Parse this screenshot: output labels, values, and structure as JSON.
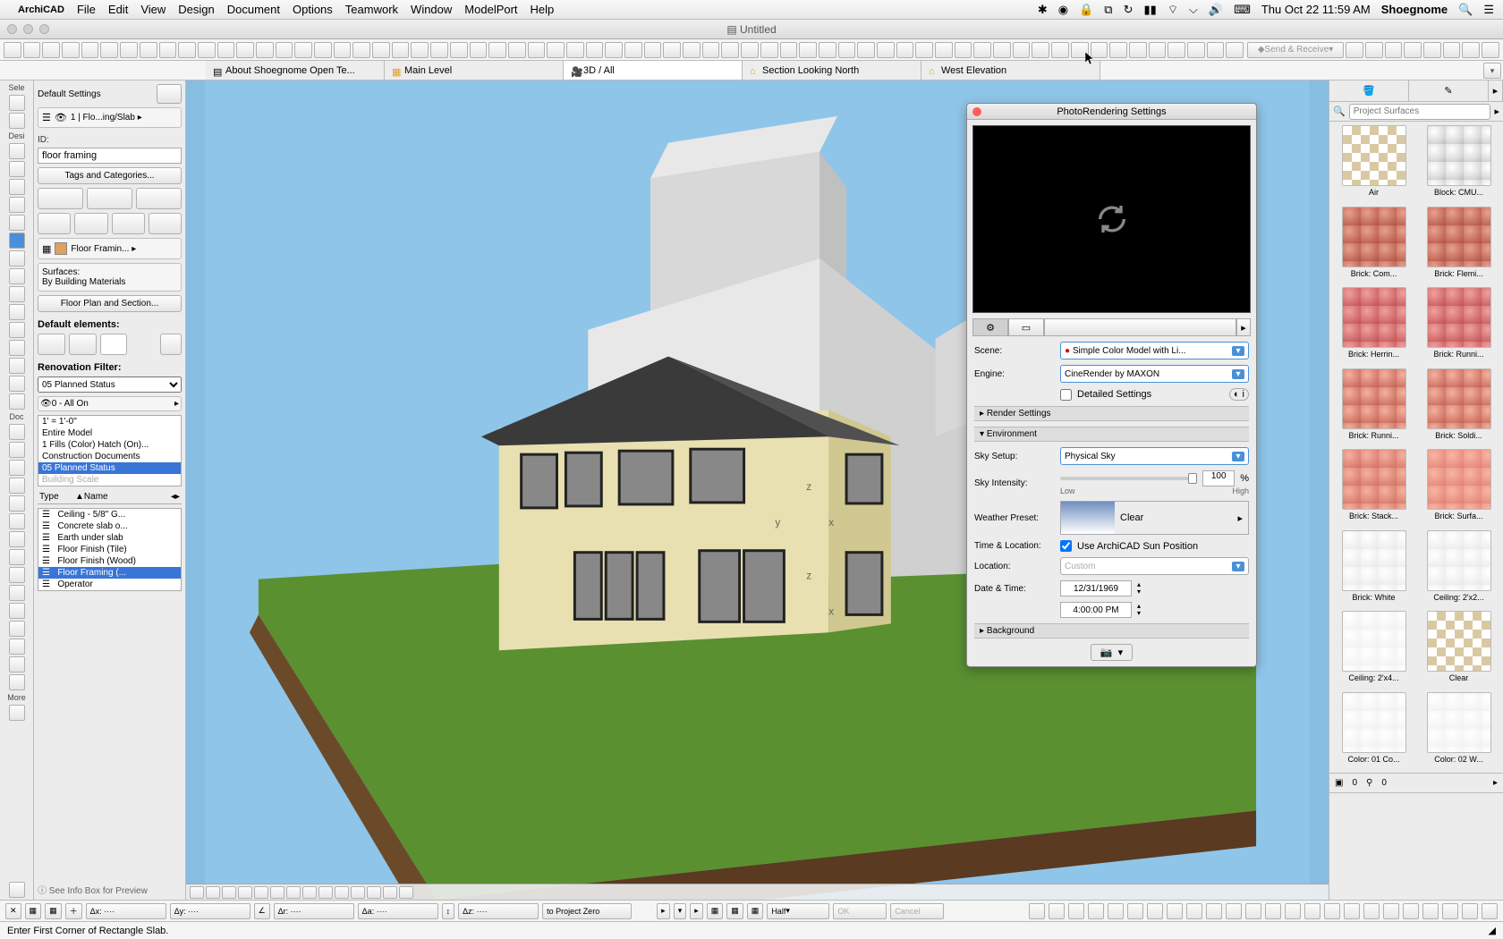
{
  "menubar": {
    "app": "ArchiCAD",
    "items": [
      "File",
      "Edit",
      "View",
      "Design",
      "Document",
      "Options",
      "Teamwork",
      "Window",
      "ModelPort",
      "Help"
    ],
    "clock": "Thu Oct 22  11:59 AM",
    "user": "Shoegnome"
  },
  "window": {
    "title": "Untitled"
  },
  "tabs": [
    {
      "label": "About Shoegnome Open Te...",
      "icon": "doc",
      "active": false
    },
    {
      "label": "Main Level",
      "icon": "plan",
      "active": false
    },
    {
      "label": "3D / All",
      "icon": "camera",
      "active": true
    },
    {
      "label": "Section Looking North",
      "icon": "section",
      "active": false
    },
    {
      "label": "West Elevation",
      "icon": "elev",
      "active": false
    }
  ],
  "leftpanel": {
    "sele": "Sele",
    "desi": "Desi",
    "doc": "Doc",
    "more": "More",
    "default_settings": "Default Settings",
    "layer_row": "1 | Flo...ing/Slab ▸",
    "id_label": "ID:",
    "id_value": "floor framing",
    "tags_btn": "Tags and Categories...",
    "composite": "Floor Framin... ▸",
    "surfaces_label": "Surfaces:",
    "surfaces_sub": "By Building Materials",
    "floorplan_btn": "Floor Plan and Section...",
    "default_elements": "Default elements:",
    "reno_label": "Renovation Filter:",
    "reno_value": "05 Planned Status",
    "layercombo": "0 - All On",
    "layerlist": [
      "1'        =        1'-0\"",
      "Entire Model",
      "1 Fills (Color) Hatch (On)...",
      "Construction Documents",
      "05 Planned Status",
      "Building Scale"
    ],
    "type_header": "Type",
    "name_header": "Name",
    "layers": [
      "Ceiling - 5/8\" G...",
      "Concrete slab o...",
      "Earth under slab",
      "Floor Finish (Tile)",
      "Floor Finish (Wood)",
      "Floor Framing (...",
      "Operator"
    ],
    "infobox": "See Info Box for Preview"
  },
  "render": {
    "title": "PhotoRendering Settings",
    "scene_lbl": "Scene:",
    "scene_val": "Simple Color Model with Li...",
    "engine_lbl": "Engine:",
    "engine_val": "CineRender by MAXON",
    "detailed": "Detailed Settings",
    "rs": "Render Settings",
    "env": "Environment",
    "sky_lbl": "Sky Setup:",
    "sky_val": "Physical Sky",
    "intensity_lbl": "Sky Intensity:",
    "intensity_val": "100",
    "pct": "%",
    "low": "Low",
    "high": "High",
    "weather_lbl": "Weather Preset:",
    "weather_val": "Clear",
    "time_lbl": "Time & Location:",
    "sun_chk": "Use ArchiCAD Sun Position",
    "loc_lbl": "Location:",
    "loc_val": "Custom",
    "date_lbl": "Date & Time:",
    "date_val": "12/31/1969",
    "time_val": "4:00:00 PM",
    "bg": "Background"
  },
  "surfaces": {
    "search_placeholder": "Project Surfaces",
    "items": [
      {
        "name": "Air",
        "color": "repeating-conic-gradient(#d9c9a3 0 25%, #fff 0 50%)"
      },
      {
        "name": "Block: CMU...",
        "color": "radial-gradient(circle at 35% 30%, #fff, #ddd 60%, #bbb)"
      },
      {
        "name": "Brick: Com...",
        "color": "radial-gradient(circle at 35% 30%, #e8a090, #b05040)"
      },
      {
        "name": "Brick: Flemi...",
        "color": "radial-gradient(circle at 35% 30%, #e8a090, #b05040)"
      },
      {
        "name": "Brick: Herrin...",
        "color": "radial-gradient(circle at 35% 30%, #f0a0a0, #c05050)"
      },
      {
        "name": "Brick: Runni...",
        "color": "radial-gradient(circle at 35% 30%, #f0a0a0, #c05050)"
      },
      {
        "name": "Brick: Runni...",
        "color": "radial-gradient(circle at 35% 30%, #f5b0a0, #c06050)"
      },
      {
        "name": "Brick: Soldi...",
        "color": "radial-gradient(circle at 35% 30%, #f5b0a0, #c06050)"
      },
      {
        "name": "Brick: Stack...",
        "color": "radial-gradient(circle at 35% 30%, #f5b0a0, #d07060)"
      },
      {
        "name": "Brick: Surfa...",
        "color": "radial-gradient(circle at 35% 30%, #f8b5a5, #e08070)"
      },
      {
        "name": "Brick: White",
        "color": "radial-gradient(circle at 35% 30%, #fff, #e8e8e8)"
      },
      {
        "name": "Ceiling: 2'x2...",
        "color": "radial-gradient(circle at 35% 30%, #fff, #e8e8e8)"
      },
      {
        "name": "Ceiling: 2'x4...",
        "color": "radial-gradient(circle at 35% 30%, #fff, #f0f0f0)"
      },
      {
        "name": "Clear",
        "color": "repeating-conic-gradient(#d9c9a3 0 25%, #fff 0 50%)"
      },
      {
        "name": "Color: 01 Co...",
        "color": "radial-gradient(circle at 35% 30%, #fff, #f0f0f0)"
      },
      {
        "name": "Color: 02 W...",
        "color": "radial-gradient(circle at 35% 30%, #fff, #f0f0f0)"
      }
    ],
    "count1": "0",
    "count2": "0"
  },
  "coordbar": {
    "dx": "Δx: ····",
    "dy": "Δy: ····",
    "dr": "Δr: ····",
    "da": "Δa: ····",
    "dz": "Δz: ····",
    "proj": "to Project Zero",
    "half": "Half",
    "ok": "OK",
    "cancel": "Cancel"
  },
  "status": "Enter First Corner of Rectangle Slab.",
  "sendreceive": "Send & Receive"
}
